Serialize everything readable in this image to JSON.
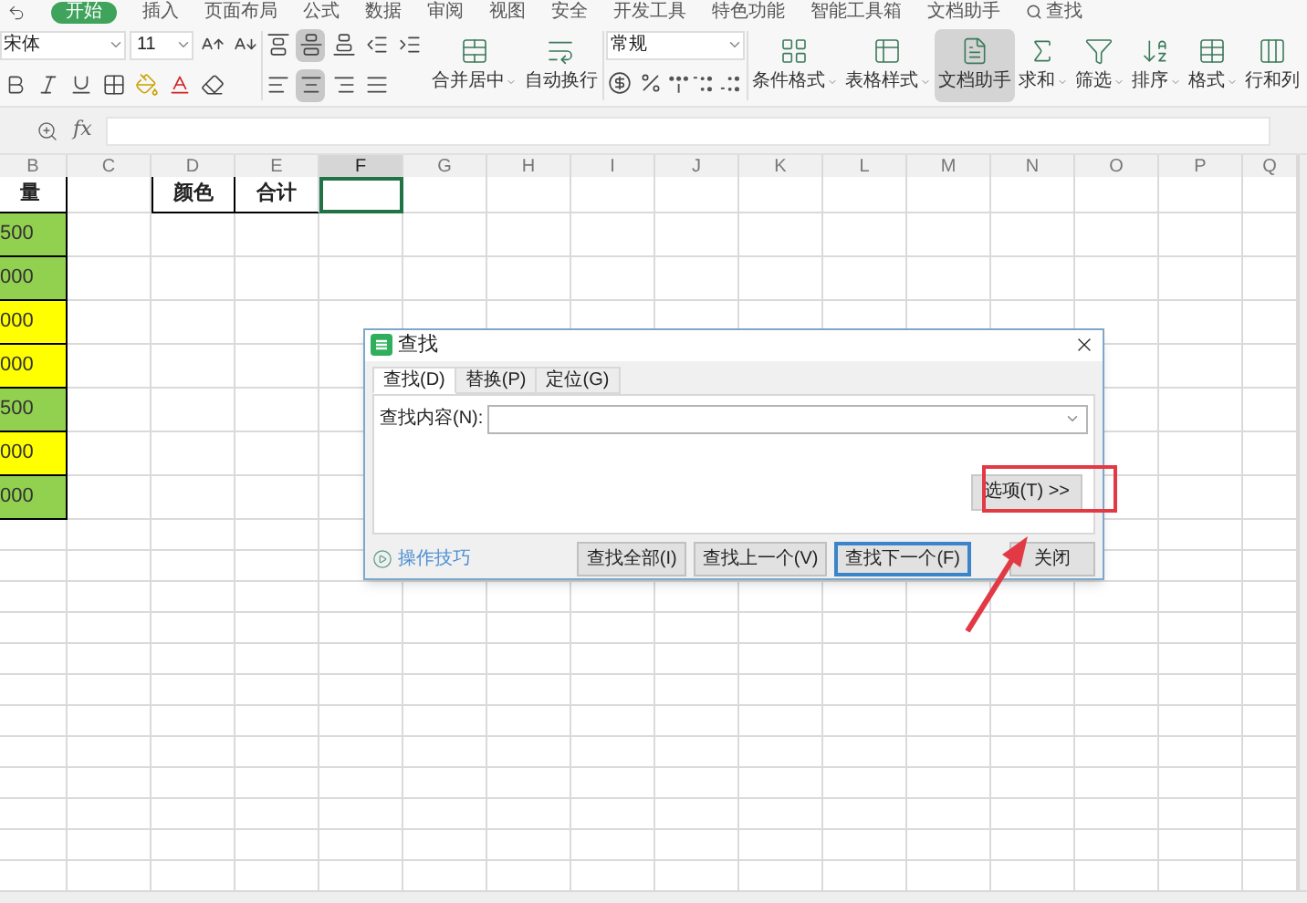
{
  "menu_tabs": [
    {
      "label": "开始",
      "selected": true
    },
    {
      "label": "插入",
      "selected": false
    },
    {
      "label": "页面布局",
      "selected": false
    },
    {
      "label": "公式",
      "selected": false
    },
    {
      "label": "数据",
      "selected": false
    },
    {
      "label": "审阅",
      "selected": false
    },
    {
      "label": "视图",
      "selected": false
    },
    {
      "label": "安全",
      "selected": false
    },
    {
      "label": "开发工具",
      "selected": false
    },
    {
      "label": "特色功能",
      "selected": false
    },
    {
      "label": "智能工具箱",
      "selected": false
    },
    {
      "label": "文档助手",
      "selected": false
    },
    {
      "label": "查找",
      "selected": false
    }
  ],
  "ribbon": {
    "font_field": {
      "value": "宋体"
    },
    "size_field": {
      "value": "11"
    },
    "number_format": {
      "value": "常规"
    },
    "vertical_align": [
      {
        "selected": false
      },
      {
        "selected": true
      },
      {
        "selected": false
      }
    ],
    "horizontal_align": [
      {
        "selected": false
      },
      {
        "selected": true
      },
      {
        "selected": false
      },
      {
        "selected": false
      }
    ],
    "buttons": [
      {
        "label": "合并居中",
        "dropdown": true,
        "selected": false
      },
      {
        "label": "自动换行",
        "dropdown": false,
        "selected": false
      },
      {
        "label": "条件格式",
        "dropdown": true,
        "selected": false
      },
      {
        "label": "表格样式",
        "dropdown": true,
        "selected": false
      },
      {
        "label": "文档助手",
        "dropdown": false,
        "selected": true
      },
      {
        "label": "求和",
        "dropdown": true,
        "selected": false
      },
      {
        "label": "筛选",
        "dropdown": true,
        "selected": false
      },
      {
        "label": "排序",
        "dropdown": true,
        "selected": false
      },
      {
        "label": "格式",
        "dropdown": true,
        "selected": false
      },
      {
        "label": "行和列",
        "dropdown": false,
        "selected": false
      }
    ]
  },
  "formula_bar": {
    "label": "fx"
  },
  "columns": [
    {
      "label": "B",
      "selected": false
    },
    {
      "label": "C",
      "selected": false
    },
    {
      "label": "D",
      "selected": false
    },
    {
      "label": "E",
      "selected": false
    },
    {
      "label": "F",
      "selected": true
    },
    {
      "label": "G",
      "selected": false
    },
    {
      "label": "H",
      "selected": false
    },
    {
      "label": "I",
      "selected": false
    },
    {
      "label": "J",
      "selected": false
    },
    {
      "label": "K",
      "selected": false
    },
    {
      "label": "L",
      "selected": false
    },
    {
      "label": "M",
      "selected": false
    },
    {
      "label": "N",
      "selected": false
    },
    {
      "label": "O",
      "selected": false
    },
    {
      "label": "P",
      "selected": false
    },
    {
      "label": "Q",
      "selected": false
    }
  ],
  "sheet": {
    "header": {
      "column_b": "量",
      "column_d": "颜色",
      "column_e": "合计",
      "active_cell_selected": true
    },
    "sales": [
      {
        "text": "500",
        "color": "#92d050"
      },
      {
        "text": "000",
        "color": "#92d050"
      },
      {
        "text": "000",
        "color": "#ffff00"
      },
      {
        "text": "000",
        "color": "#ffff00"
      },
      {
        "text": "500",
        "color": "#92d050"
      },
      {
        "text": "000",
        "color": "#ffff00"
      },
      {
        "text": "000",
        "color": "#92d050"
      }
    ]
  },
  "dialog": {
    "title": "查找",
    "tabs": [
      {
        "label": "查找(D)",
        "selected": true
      },
      {
        "label": "替换(P)",
        "selected": false
      },
      {
        "label": "定位(G)",
        "selected": false
      }
    ],
    "find_label": "查找内容(N):",
    "options_button": "选项(T) >>",
    "tips_link": "操作技巧",
    "buttons": [
      {
        "label": "查找全部(I)",
        "focused": false
      },
      {
        "label": "查找上一个(V)",
        "focused": false
      },
      {
        "label": "查找下一个(F)",
        "focused": true
      },
      {
        "label": "关闭",
        "focused": false
      }
    ]
  }
}
